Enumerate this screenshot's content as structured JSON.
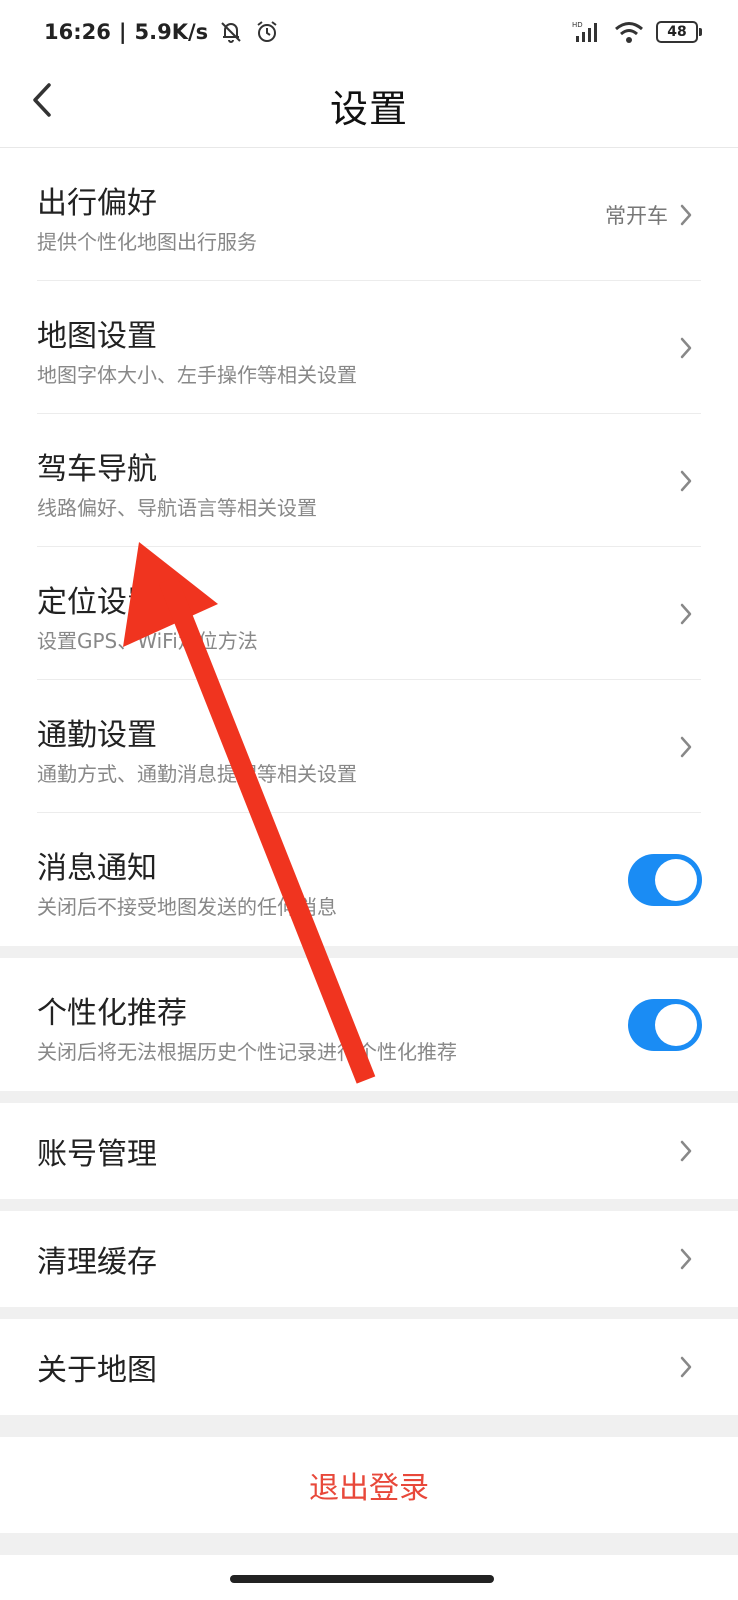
{
  "status_bar": {
    "time": "16:26",
    "separator": "|",
    "net_speed": "5.9K/s",
    "battery": "48",
    "icons": [
      "mute-bell-icon",
      "alarm-icon",
      "hd-signal-icon",
      "wifi-icon",
      "battery-icon"
    ]
  },
  "header": {
    "title": "设置",
    "back_icon": "chevron-left-icon"
  },
  "settings": [
    {
      "title": "出行偏好",
      "subtitle": "提供个性化地图出行服务",
      "value": "常开车",
      "control": "chevron"
    },
    {
      "title": "地图设置",
      "subtitle": "地图字体大小、左手操作等相关设置",
      "control": "chevron"
    },
    {
      "title": "驾车导航",
      "subtitle": "线路偏好、导航语言等相关设置",
      "control": "chevron"
    },
    {
      "title": "定位设置",
      "subtitle": "设置GPS、WiFi定位方法",
      "control": "chevron"
    },
    {
      "title": "通勤设置",
      "subtitle": "通勤方式、通勤消息提醒等相关设置",
      "control": "chevron"
    },
    {
      "title": "消息通知",
      "subtitle": "关闭后不接受地图发送的任何消息",
      "control": "toggle",
      "on": true
    }
  ],
  "personalized": {
    "title": "个性化推荐",
    "subtitle": "关闭后将无法根据历史个性记录进行个性化推荐",
    "control": "toggle",
    "on": true
  },
  "simple_items": [
    {
      "title": "账号管理"
    },
    {
      "title": "清理缓存"
    },
    {
      "title": "关于地图"
    }
  ],
  "logout": {
    "label": "退出登录"
  },
  "colors": {
    "accent": "#1a8cf4",
    "logout": "#e8483a",
    "annotation_arrow": "#f0341f",
    "section_gap": "#f0f0f0"
  }
}
